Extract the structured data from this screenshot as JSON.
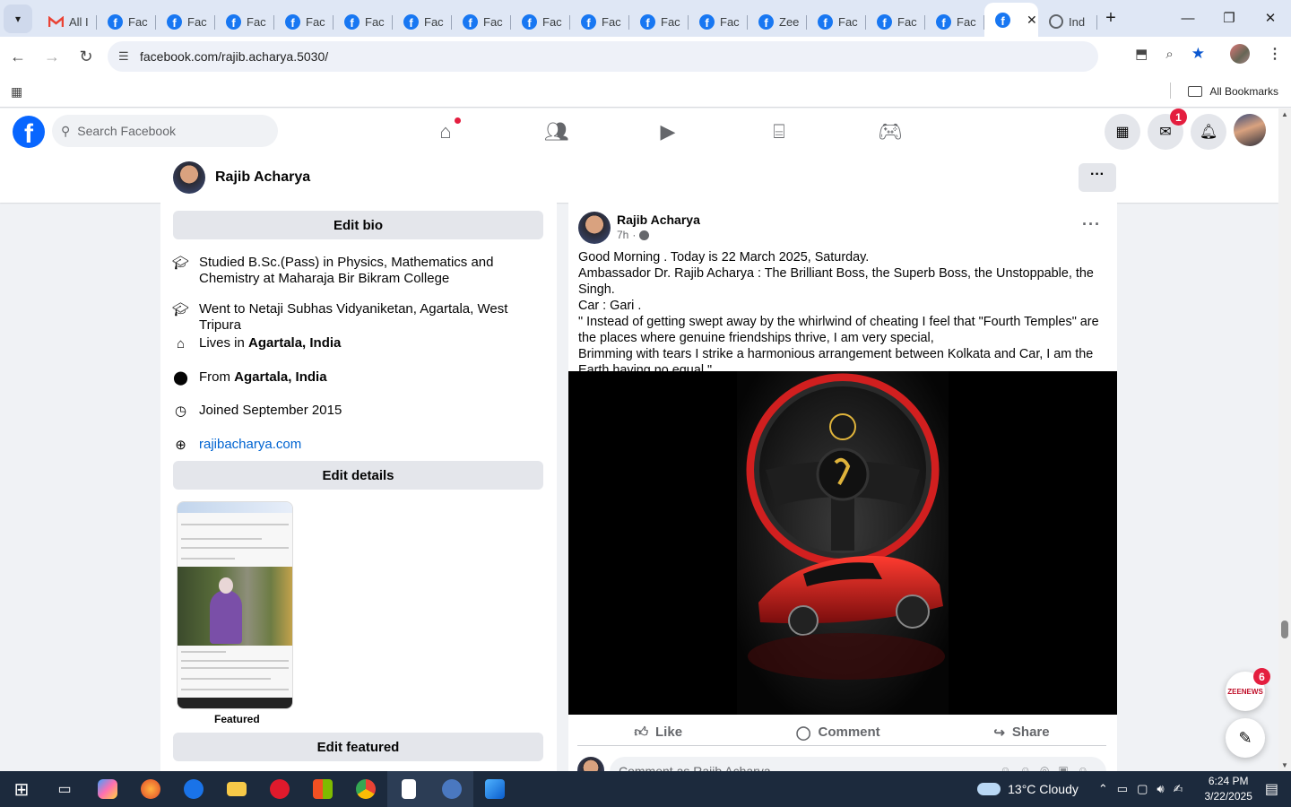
{
  "browser": {
    "tabs": [
      {
        "label": "All I",
        "icon": "gmail-icon"
      },
      {
        "label": "Fac",
        "icon": "facebook-icon"
      },
      {
        "label": "Fac",
        "icon": "facebook-icon"
      },
      {
        "label": "Fac",
        "icon": "facebook-icon"
      },
      {
        "label": "Fac",
        "icon": "facebook-icon"
      },
      {
        "label": "Fac",
        "icon": "facebook-icon"
      },
      {
        "label": "Fac",
        "icon": "facebook-icon"
      },
      {
        "label": "Fac",
        "icon": "facebook-icon"
      },
      {
        "label": "Fac",
        "icon": "facebook-icon"
      },
      {
        "label": "Fac",
        "icon": "facebook-icon"
      },
      {
        "label": "Fac",
        "icon": "facebook-icon"
      },
      {
        "label": "Fac",
        "icon": "facebook-icon"
      },
      {
        "label": "Zee",
        "icon": "facebook-icon"
      },
      {
        "label": "Fac",
        "icon": "facebook-icon"
      },
      {
        "label": "Fac",
        "icon": "facebook-icon"
      },
      {
        "label": "Fac",
        "icon": "facebook-icon"
      },
      {
        "label": "",
        "icon": "facebook-icon",
        "active": true
      },
      {
        "label": "Ind",
        "icon": "globe-icon"
      }
    ],
    "url": "facebook.com/rajib.acharya.5030/",
    "bookmarks_label": "All Bookmarks"
  },
  "fb": {
    "search_placeholder": "Search Facebook",
    "messenger_badge": "1",
    "brand_color": "#0866ff"
  },
  "profile": {
    "name": "Rajib Acharya"
  },
  "intro": {
    "edit_bio": "Edit bio",
    "study": "Studied B.Sc.(Pass) in Physics, Mathematics and Chemistry at Maharaja Bir Bikram College",
    "school": "Went to Netaji Subhas Vidyaniketan, Agartala, West Tripura",
    "lives_prefix": "Lives in ",
    "lives_place": "Agartala, India",
    "from_prefix": "From ",
    "from_place": "Agartala, India",
    "joined": "Joined September 2015",
    "website": "rajibacharya.com",
    "edit_details": "Edit details",
    "featured_label": "Featured",
    "edit_featured": "Edit featured"
  },
  "post": {
    "author": "Rajib Acharya",
    "time": "7h",
    "lines": [
      "Good Morning . Today is 22 March 2025, Saturday.",
      "Ambassador Dr. Rajib Acharya : The Brilliant Boss, the Superb Boss, the Unstoppable, the Singh.",
      "Car : Gari .",
      "\" Instead of getting swept away by the whirlwind of cheating I feel that \"Fourth Temples\" are the places where genuine friendships thrive, I am very special,",
      "Brimming with tears I strike a harmonious arrangement between Kolkata and Car, I am the Earth having no equal.\""
    ],
    "like": "Like",
    "comment": "Comment",
    "share": "Share",
    "comment_placeholder": "Comment as Rajib Acharya"
  },
  "floating": {
    "news_badge": "6",
    "news_label": "ZEENEWS"
  },
  "taskbar": {
    "weather": "13°C  Cloudy",
    "time": "6:24 PM",
    "date": "3/22/2025"
  }
}
